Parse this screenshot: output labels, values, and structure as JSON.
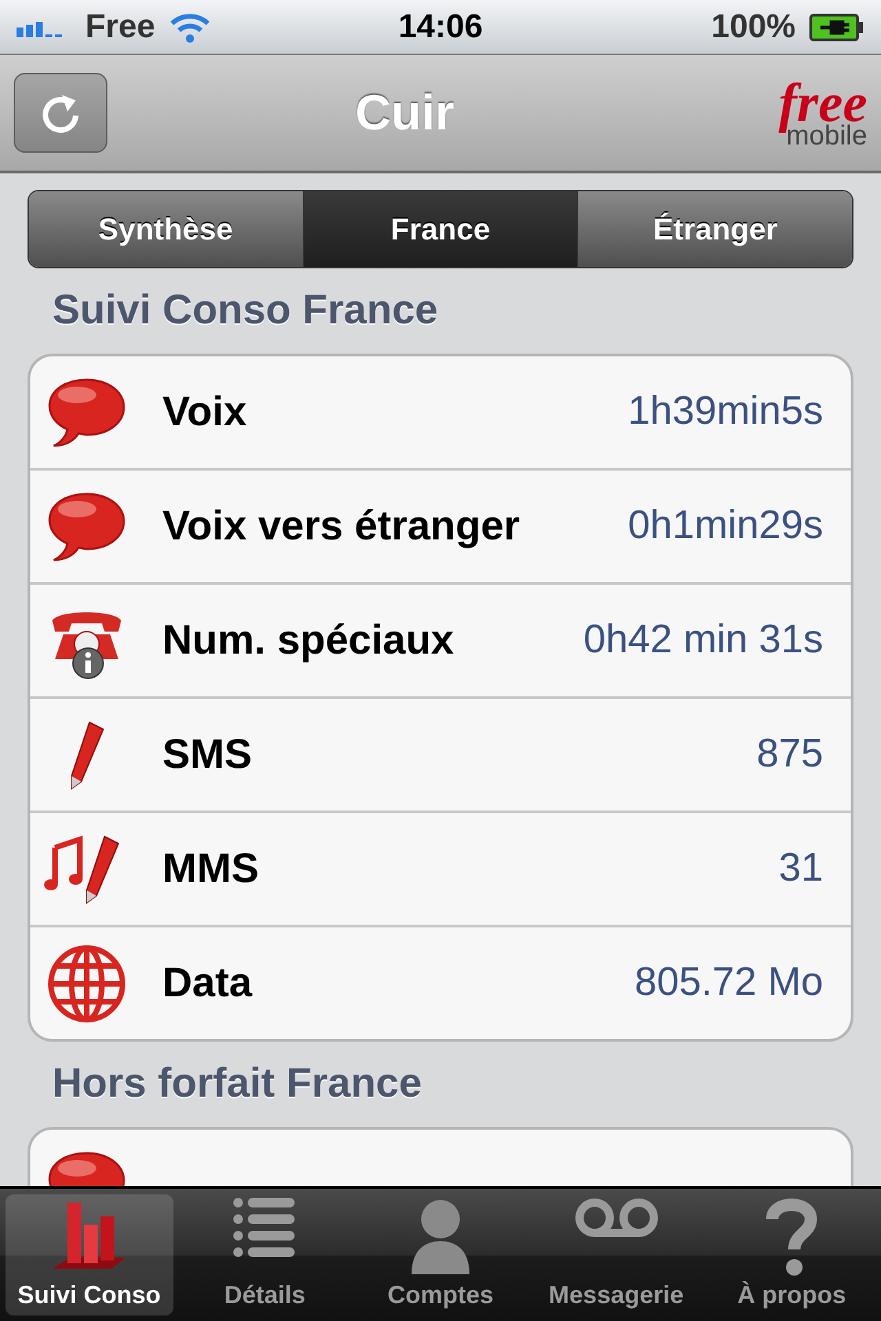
{
  "status_bar": {
    "carrier": "Free",
    "time": "14:06",
    "battery": "100%"
  },
  "nav_bar": {
    "title": "Cuir",
    "logo": {
      "top": "free",
      "bottom": "mobile"
    }
  },
  "segments": [
    {
      "label": "Synthèse",
      "selected": false
    },
    {
      "label": "France",
      "selected": true
    },
    {
      "label": "Étranger",
      "selected": false
    }
  ],
  "sections": [
    {
      "title": "Suivi Conso France",
      "rows": [
        {
          "kind": "voice",
          "label": "Voix",
          "value": "1h39min5s"
        },
        {
          "kind": "voice",
          "label": "Voix vers étranger",
          "value": "0h1min29s"
        },
        {
          "kind": "phone",
          "label": "Num. spéciaux",
          "value": "0h42 min 31s"
        },
        {
          "kind": "sms",
          "label": "SMS",
          "value": "875"
        },
        {
          "kind": "mms",
          "label": "MMS",
          "value": "31"
        },
        {
          "kind": "data",
          "label": "Data",
          "value": "805.72 Mo"
        }
      ]
    },
    {
      "title": "Hors forfait France",
      "rows": [
        {
          "kind": "voice"
        }
      ]
    }
  ],
  "tab_bar": [
    {
      "label": "Suivi Conso",
      "selected": true
    },
    {
      "label": "Détails",
      "selected": false
    },
    {
      "label": "Comptes",
      "selected": false
    },
    {
      "label": "Messagerie",
      "selected": false
    },
    {
      "label": "À propos",
      "selected": false
    }
  ]
}
